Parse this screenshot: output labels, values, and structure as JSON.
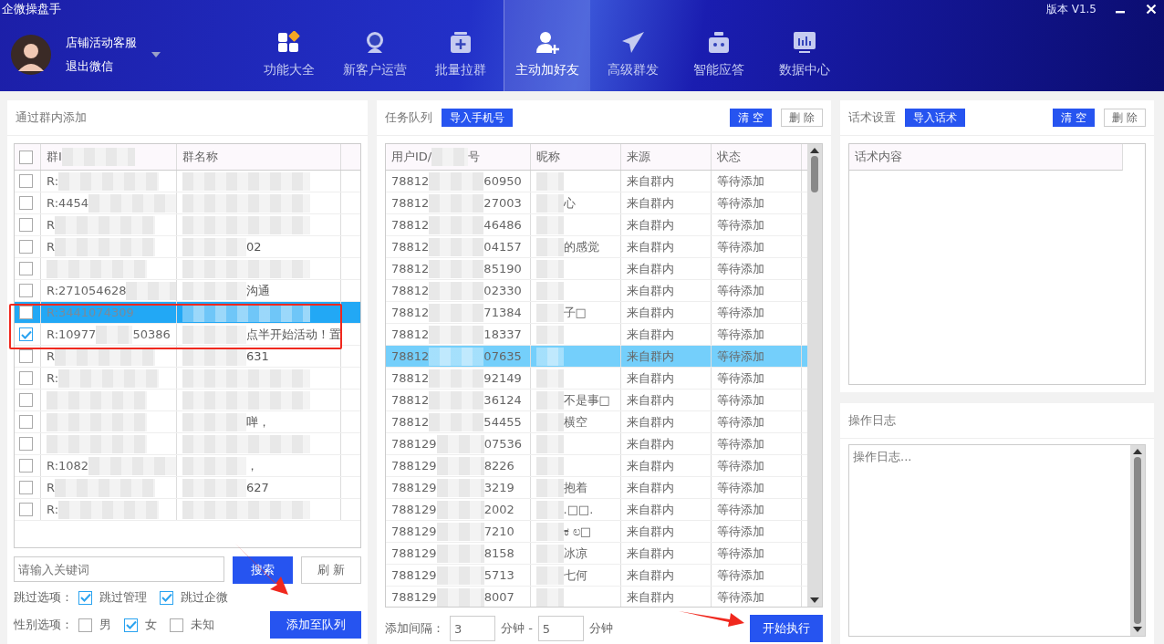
{
  "window": {
    "title": "企微操盘手",
    "version": "版本 V1.5"
  },
  "account": {
    "name": "店铺活动客服",
    "logout": "退出微信"
  },
  "nav": [
    {
      "label": "功能大全",
      "kind": "grid",
      "selected": false
    },
    {
      "label": "新客户运营",
      "kind": "new",
      "selected": false
    },
    {
      "label": "批量拉群",
      "kind": "box",
      "selected": false
    },
    {
      "label": "主动加好友",
      "kind": "adduser",
      "selected": true
    },
    {
      "label": "高级群发",
      "kind": "plane",
      "selected": false
    },
    {
      "label": "智能应答",
      "kind": "robot",
      "selected": false
    },
    {
      "label": "数据中心",
      "kind": "chart",
      "selected": false
    }
  ],
  "group_panel": {
    "title": "通过群内添加",
    "select_all_checked": false,
    "columns": [
      "群I",
      "群名称"
    ],
    "rows": [
      {
        "checked": false,
        "selected": false,
        "id_head": "R:"
      },
      {
        "checked": false,
        "selected": false,
        "id_head": "R:4454"
      },
      {
        "checked": false,
        "selected": false,
        "id_head": "R"
      },
      {
        "checked": false,
        "selected": false,
        "id_head": "R",
        "name_tail": "02"
      },
      {
        "checked": false,
        "selected": false
      },
      {
        "checked": false,
        "selected": false,
        "id_head": "R:271054628",
        "name_tail": "沟通"
      },
      {
        "checked": false,
        "selected": true,
        "id_head": "R:3441074309"
      },
      {
        "checked": true,
        "selected": false,
        "id_head": "R:10977",
        "id_tail": "50386",
        "name_tail": "点半开始活动！置"
      },
      {
        "checked": false,
        "selected": false,
        "id_head": "R",
        "name_tail": "631"
      },
      {
        "checked": false,
        "selected": false,
        "id_head": "R:"
      },
      {
        "checked": false,
        "selected": false
      },
      {
        "checked": false,
        "selected": false,
        "name_tail": "啴，"
      },
      {
        "checked": false,
        "selected": false
      },
      {
        "checked": false,
        "selected": false,
        "id_head": "R:1082",
        "name_tail": "，"
      },
      {
        "checked": false,
        "selected": false,
        "id_head": "R",
        "name_tail": "627"
      },
      {
        "checked": false,
        "selected": false,
        "id_head": "R:"
      }
    ],
    "search": {
      "placeholder": "请输入关键词"
    },
    "search_button": "搜索",
    "refresh_button": "刷 新",
    "skip_label": "跳过选项：",
    "skip_options": [
      {
        "label": "跳过管理",
        "checked": true
      },
      {
        "label": "跳过企微",
        "checked": true
      }
    ],
    "gender_label": "性别选项：",
    "gender_options": [
      {
        "label": "男",
        "checked": false
      },
      {
        "label": "女",
        "checked": true
      },
      {
        "label": "未知",
        "checked": false
      }
    ],
    "add_button": "添加至队列"
  },
  "queue_panel": {
    "title": "任务队列",
    "import_button": "导入手机号",
    "clear_button": "清 空",
    "delete_button": "删 除",
    "columns": [
      {
        "head": "用户ID/",
        "tail": "号"
      },
      {
        "head": "昵称"
      },
      {
        "head": "来源"
      },
      {
        "head": "状态"
      }
    ],
    "rows": [
      {
        "selected": false,
        "id_head": "78812",
        "id_tail": "60950",
        "source": "来自群内",
        "status": "等待添加"
      },
      {
        "selected": false,
        "id_head": "78812",
        "id_tail": "27003",
        "nick_tail": "心",
        "source": "来自群内",
        "status": "等待添加"
      },
      {
        "selected": false,
        "id_head": "78812",
        "id_tail": "46486",
        "source": "来自群内",
        "status": "等待添加"
      },
      {
        "selected": false,
        "id_head": "78812",
        "id_tail": "04157",
        "nick_tail": "的感觉",
        "source": "来自群内",
        "status": "等待添加"
      },
      {
        "selected": false,
        "id_head": "78812",
        "id_tail": "85190",
        "source": "来自群内",
        "status": "等待添加"
      },
      {
        "selected": false,
        "id_head": "78812",
        "id_tail": "02330",
        "source": "来自群内",
        "status": "等待添加"
      },
      {
        "selected": false,
        "id_head": "78812",
        "id_tail": "71384",
        "nick_tail": "子□",
        "source": "来自群内",
        "status": "等待添加"
      },
      {
        "selected": false,
        "id_head": "78812",
        "id_tail": "18337",
        "source": "来自群内",
        "status": "等待添加"
      },
      {
        "selected": true,
        "id_head": "78812",
        "id_tail": "07635",
        "source": "来自群内",
        "status": "等待添加"
      },
      {
        "selected": false,
        "id_head": "78812",
        "id_tail": "92149",
        "source": "来自群内",
        "status": "等待添加"
      },
      {
        "selected": false,
        "id_head": "78812",
        "id_tail": "36124",
        "nick_tail": "不是事□",
        "source": "来自群内",
        "status": "等待添加"
      },
      {
        "selected": false,
        "id_head": "78812",
        "id_tail": "54455",
        "nick_tail": "横空",
        "source": "来自群内",
        "status": "等待添加"
      },
      {
        "selected": false,
        "id_head": "788129",
        "id_tail": "07536",
        "source": "来自群内",
        "status": "等待添加"
      },
      {
        "selected": false,
        "id_head": "788129",
        "id_tail": "8226",
        "source": "来自群内",
        "status": "等待添加"
      },
      {
        "selected": false,
        "id_head": "788129",
        "id_tail": "3219",
        "nick_tail": "抱着",
        "source": "来自群内",
        "status": "等待添加"
      },
      {
        "selected": false,
        "id_head": "788129",
        "id_tail": "2002",
        "nick_tail": ".□□.",
        "source": "来自群内",
        "status": "等待添加"
      },
      {
        "selected": false,
        "id_head": "788129",
        "id_tail": "7210",
        "nick_tail": "ಕ ಲ□",
        "source": "来自群内",
        "status": "等待添加"
      },
      {
        "selected": false,
        "id_head": "788129",
        "id_tail": "8158",
        "nick_tail": "冰凉",
        "source": "来自群内",
        "status": "等待添加"
      },
      {
        "selected": false,
        "id_head": "788129",
        "id_tail": "5713",
        "nick_tail": "七何",
        "source": "来自群内",
        "status": "等待添加"
      },
      {
        "selected": false,
        "id_head": "788129",
        "id_tail": "8007",
        "source": "来自群内",
        "status": "等待添加"
      }
    ],
    "interval_label": "添加间隔：",
    "interval_min": "3",
    "unit_dash": "分钟 -",
    "interval_max": "5",
    "unit": "分钟",
    "start_button": "开始执行"
  },
  "script_panel": {
    "title": "话术设置",
    "import_button": "导入话术",
    "clear_button": "清 空",
    "delete_button": "删 除",
    "column": "话术内容"
  },
  "log_panel": {
    "title": "操作日志",
    "placeholder": "操作日志..."
  }
}
